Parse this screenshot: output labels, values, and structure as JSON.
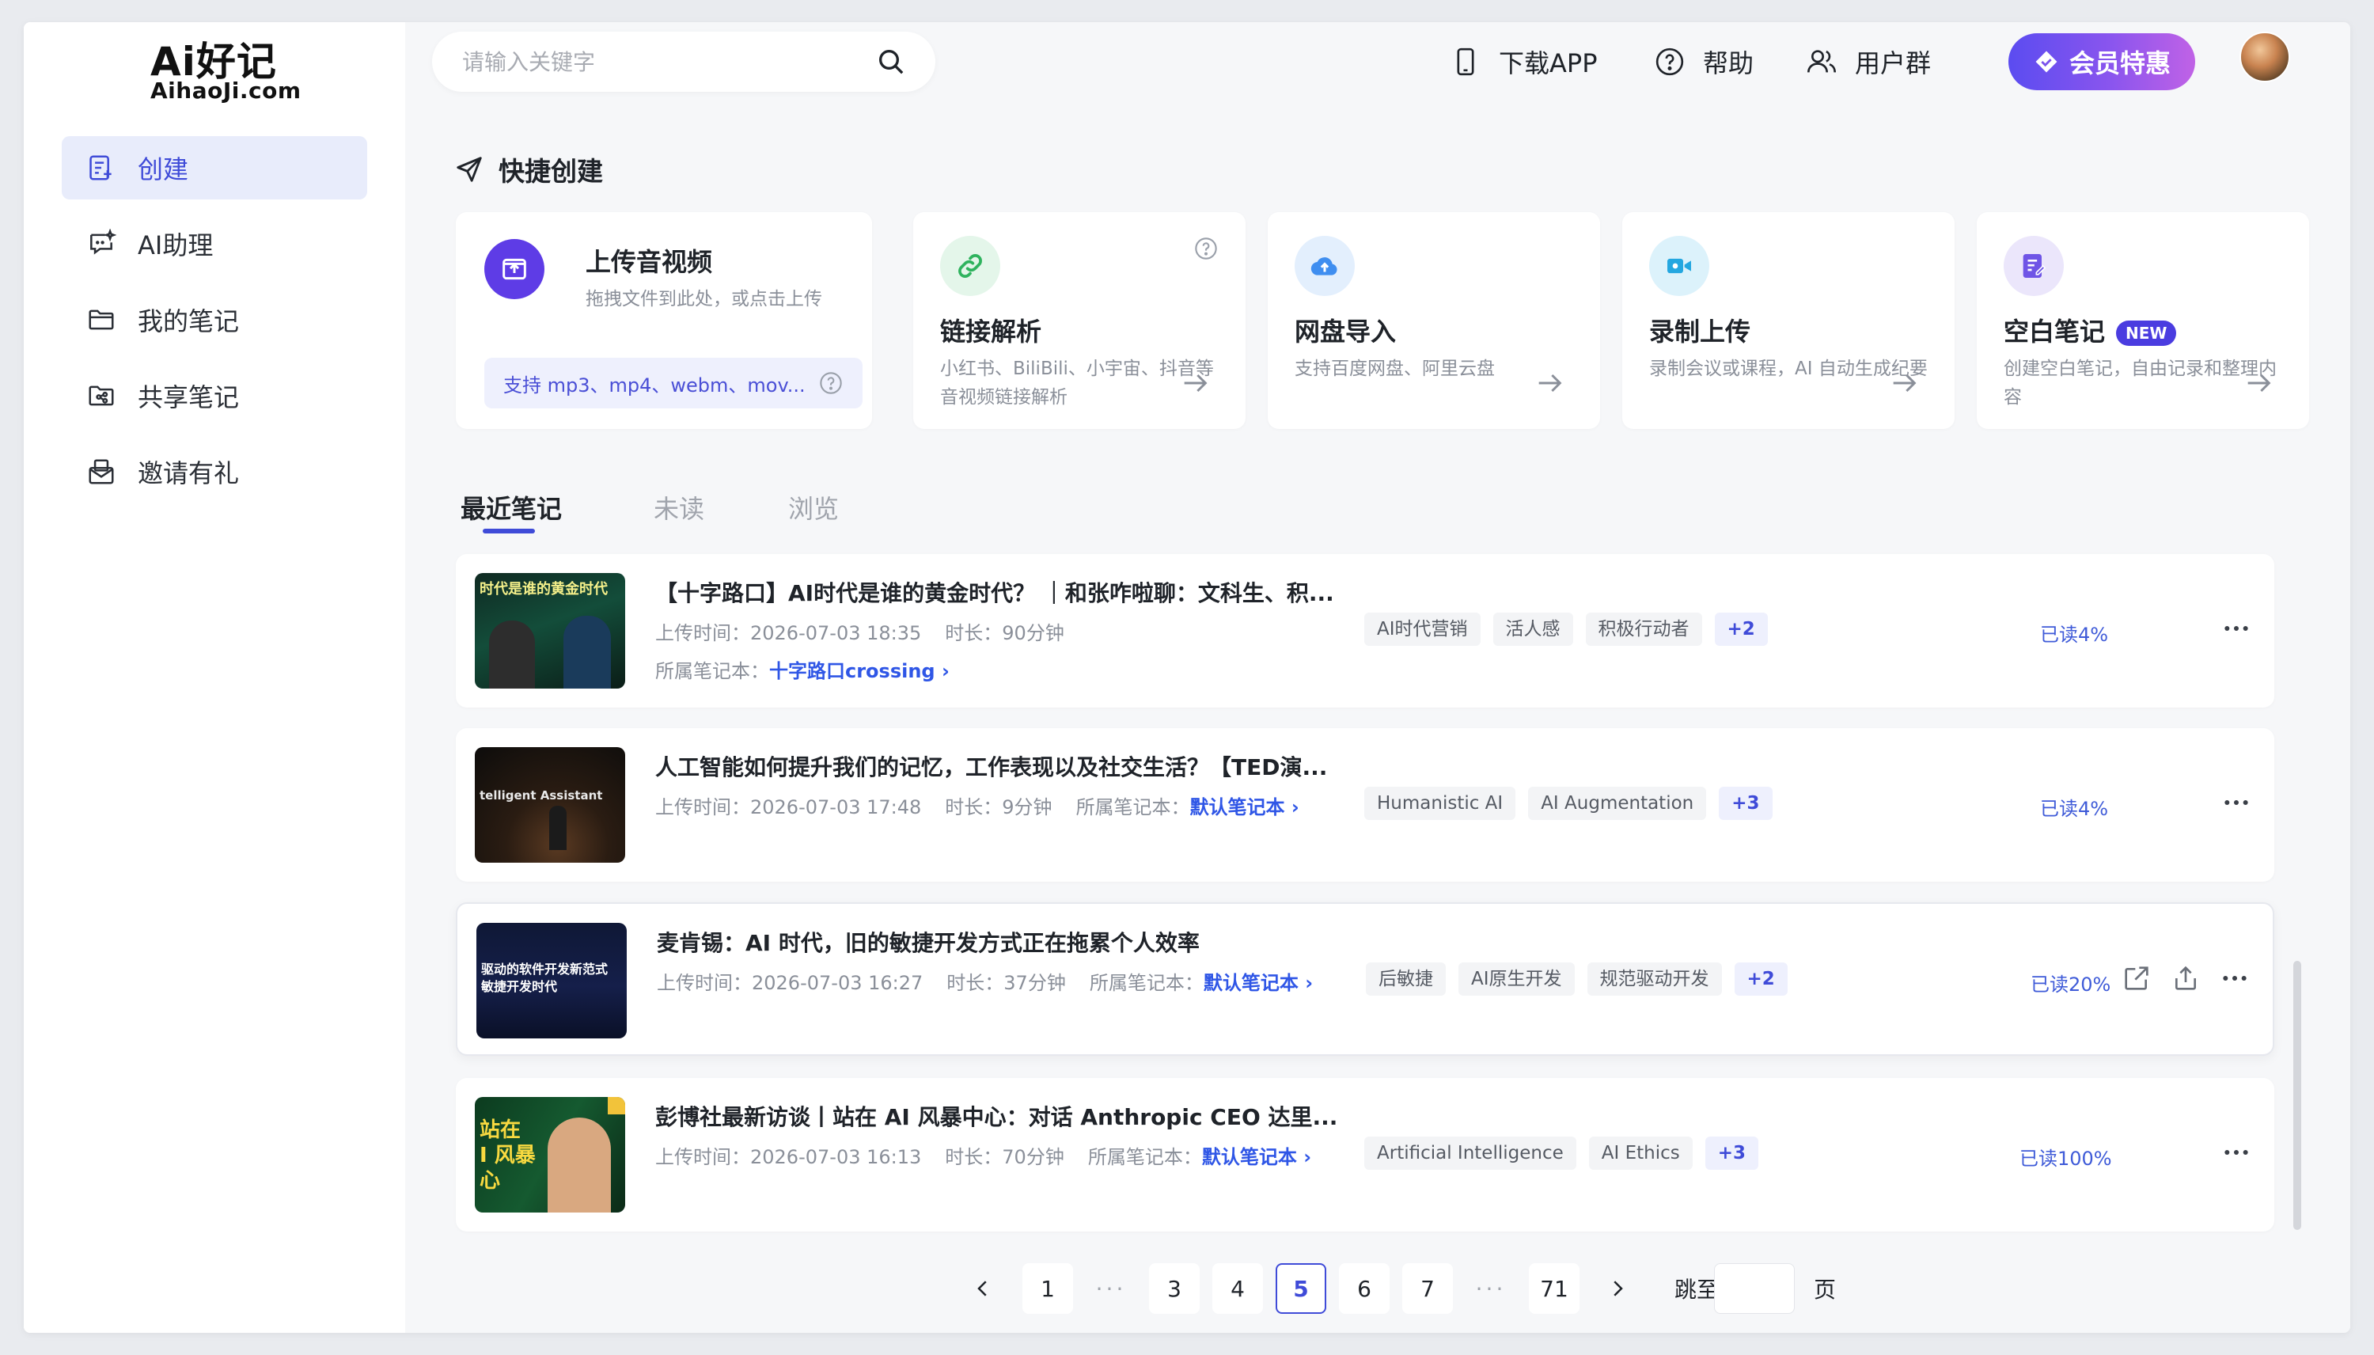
{
  "logo": {
    "main": "Ai好记",
    "sub": "AihaoJi.com"
  },
  "sidebar": {
    "items": [
      {
        "label": "创建",
        "icon": "create-icon",
        "active": true
      },
      {
        "label": "AI助理",
        "icon": "ai-assistant-icon"
      },
      {
        "label": "我的笔记",
        "icon": "folder-icon"
      },
      {
        "label": "共享笔记",
        "icon": "shared-folder-icon"
      },
      {
        "label": "邀请有礼",
        "icon": "gift-mail-icon"
      }
    ]
  },
  "header": {
    "search_placeholder": "请输入关键字",
    "download_app": "下载APP",
    "help": "帮助",
    "user_group": "用户群",
    "vip_label": "会员特惠"
  },
  "quick_create": {
    "title": "快捷创建",
    "upload": {
      "title": "上传音视频",
      "desc": "拖拽文件到此处，或点击上传",
      "formats": "支持 mp3、mp4、webm、mov..."
    },
    "cards": [
      {
        "title": "链接解析",
        "desc": "小红书、BiliBili、小宇宙、抖音等音视频链接解析",
        "icon": "link-icon"
      },
      {
        "title": "网盘导入",
        "desc": "支持百度网盘、阿里云盘",
        "icon": "cloud-upload-icon"
      },
      {
        "title": "录制上传",
        "desc": "录制会议或课程，AI 自动生成纪要",
        "icon": "video-camera-icon"
      },
      {
        "title": "空白笔记",
        "desc": "创建空白笔记，自由记录和整理内容",
        "icon": "edit-note-icon",
        "badge": "NEW"
      }
    ]
  },
  "tabs": [
    "最近笔记",
    "未读",
    "浏览"
  ],
  "notes": [
    {
      "title": "【十字路口】AI时代是谁的黄金时代？ ｜和张咋啦聊：文科生、积...",
      "upload_label": "上传时间：",
      "upload_time": "2026-07-03 18:35",
      "duration_label": "时长：",
      "duration": "90分钟",
      "notebook_label": "所属笔记本：",
      "notebook": "十字路口crossing",
      "tags": [
        "AI时代营销",
        "活人感",
        "积极行动者"
      ],
      "more": "+2",
      "read": "已读4%",
      "thumb_text": "时代是谁的黄金时代"
    },
    {
      "title": "人工智能如何提升我们的记忆，工作表现以及社交生活？【TED演...",
      "upload_label": "上传时间：",
      "upload_time": "2026-07-03 17:48",
      "duration_label": "时长：",
      "duration": "9分钟",
      "notebook_label": "所属笔记本：",
      "notebook": "默认笔记本",
      "tags": [
        "Humanistic AI",
        "AI Augmentation"
      ],
      "more": "+3",
      "read": "已读4%",
      "thumb_text": "telligent Assistant"
    },
    {
      "title": "麦肯锡：AI 时代，旧的敏捷开发方式正在拖累个人效率",
      "upload_label": "上传时间：",
      "upload_time": "2026-07-03 16:27",
      "duration_label": "时长：",
      "duration": "37分钟",
      "notebook_label": "所属笔记本：",
      "notebook": "默认笔记本",
      "tags": [
        "后敏捷",
        "AI原生开发",
        "规范驱动开发"
      ],
      "more": "+2",
      "read": "已读20%",
      "thumb_text": "驱动的软件开发新范式\n敏捷开发时代"
    },
    {
      "title": "彭博社最新访谈丨站在 AI 风暴中心：对话 Anthropic CEO 达里...",
      "upload_label": "上传时间：",
      "upload_time": "2026-07-03 16:13",
      "duration_label": "时长：",
      "duration": "70分钟",
      "notebook_label": "所属笔记本：",
      "notebook": "默认笔记本",
      "tags": [
        "Artificial Intelligence",
        "AI Ethics"
      ],
      "more": "+3",
      "read": "已读100%",
      "thumb_text": "站在\nI 风暴\n心"
    }
  ],
  "pagination": {
    "pages": [
      "1",
      "3",
      "4",
      "5",
      "6",
      "7",
      "71"
    ],
    "current": "5",
    "dots": "···",
    "jump_label": "跳至",
    "page_suffix": "页"
  },
  "colors": {
    "accent": "#3f4bd8",
    "link": "#2f56e6",
    "vip_gradient": [
      "#5b4cf0",
      "#c062e6"
    ]
  }
}
